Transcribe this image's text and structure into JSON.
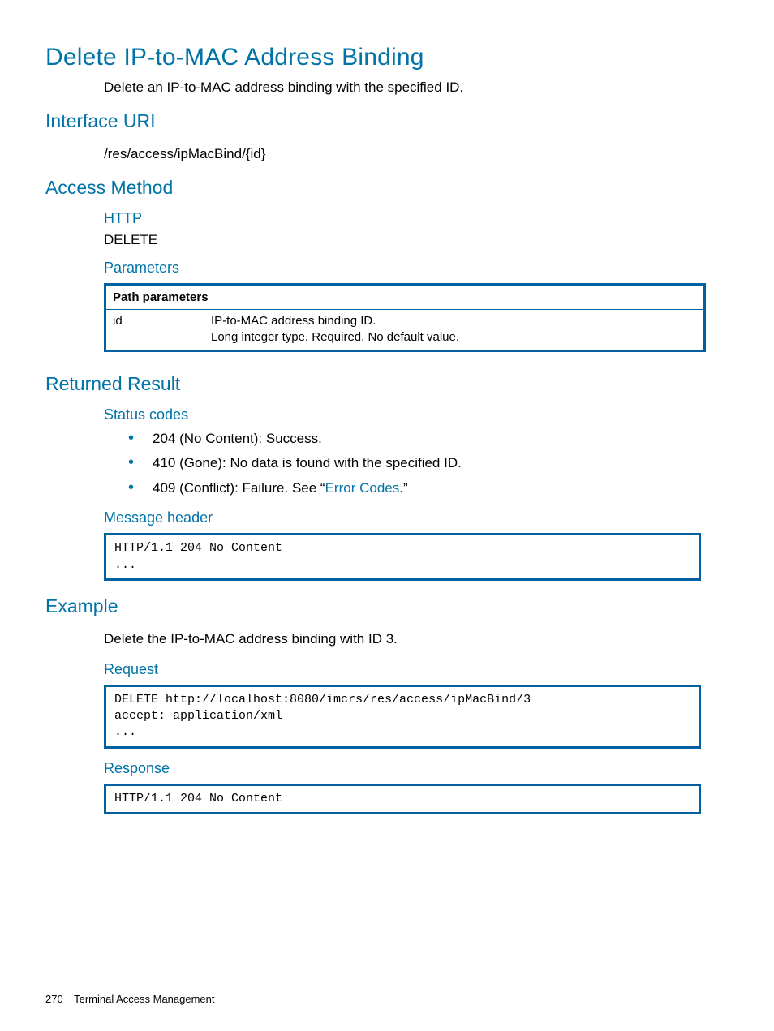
{
  "title": "Delete IP-to-MAC Address Binding",
  "intro": "Delete an IP-to-MAC address binding with the specified ID.",
  "interface_uri": {
    "heading": "Interface URI",
    "value": "/res/access/ipMacBind/{id}"
  },
  "access_method": {
    "heading": "Access Method",
    "http_heading": "HTTP",
    "http_value": "DELETE",
    "params_heading": "Parameters",
    "table_header": "Path parameters",
    "param_name": "id",
    "param_desc_line1": "IP-to-MAC address binding ID.",
    "param_desc_line2": "Long integer type. Required. No default value."
  },
  "returned": {
    "heading": "Returned Result",
    "status_heading": "Status codes",
    "statuses": {
      "s0": "204 (No Content): Success.",
      "s1": "410 (Gone): No data is found with the specified ID.",
      "s2_pre": "409 (Conflict): Failure. See “",
      "s2_link": "Error Codes",
      "s2_post": ".”"
    },
    "msg_heading": "Message header",
    "msg_code": "HTTP/1.1 204 No Content\n..."
  },
  "example": {
    "heading": "Example",
    "intro": "Delete the IP-to-MAC address binding with ID 3.",
    "request_heading": "Request",
    "request_code": "DELETE http://localhost:8080/imcrs/res/access/ipMacBind/3\naccept: application/xml\n...",
    "response_heading": "Response",
    "response_code": "HTTP/1.1 204 No Content"
  },
  "footer": {
    "page": "270",
    "section": "Terminal Access Management"
  }
}
